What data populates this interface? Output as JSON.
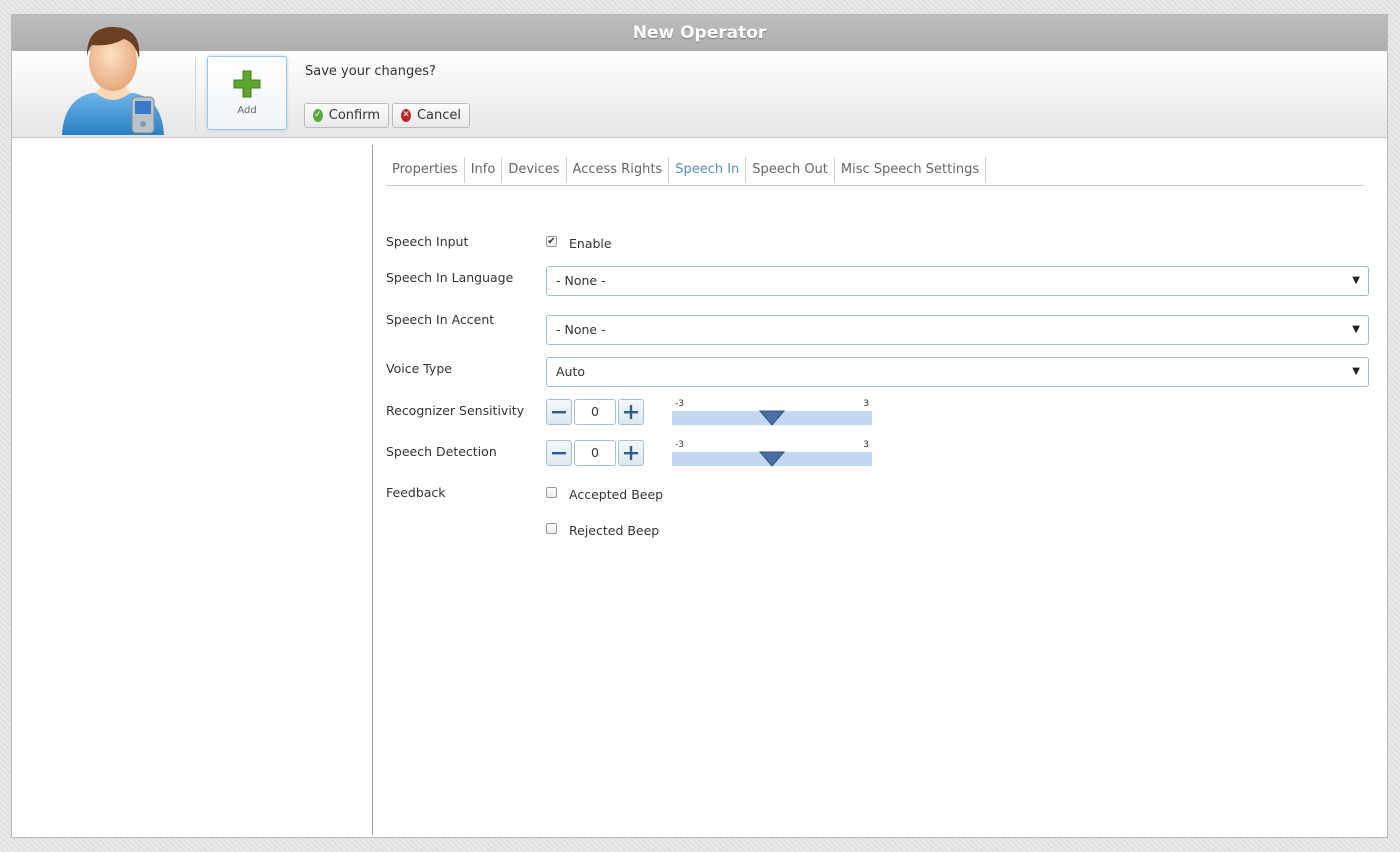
{
  "window": {
    "title": "New Operator"
  },
  "toolbar": {
    "add_label": "Add",
    "prompt": "Save your changes?",
    "confirm_label": "Confirm",
    "cancel_label": "Cancel"
  },
  "tabs": [
    {
      "label": "Properties"
    },
    {
      "label": "Info"
    },
    {
      "label": "Devices"
    },
    {
      "label": "Access Rights"
    },
    {
      "label": "Speech In",
      "active": true
    },
    {
      "label": "Speech Out"
    },
    {
      "label": "Misc Speech Settings"
    }
  ],
  "form": {
    "speech_input": {
      "label": "Speech Input",
      "checkbox_label": "Enable",
      "checked": true
    },
    "speech_in_language": {
      "label": "Speech In Language",
      "value": "- None -"
    },
    "speech_in_accent": {
      "label": "Speech In Accent",
      "value": "- None -"
    },
    "voice_type": {
      "label": "Voice Type",
      "value": "Auto"
    },
    "recognizer_sensitivity": {
      "label": "Recognizer Sensitivity",
      "value": "0",
      "min": "-3",
      "max": "3",
      "level": 0
    },
    "speech_detection": {
      "label": "Speech Detection",
      "value": "0",
      "min": "-3",
      "max": "3",
      "level": 0
    },
    "feedback": {
      "label": "Feedback",
      "accepted_beep": {
        "label": "Accepted Beep",
        "checked": false
      },
      "rejected_beep": {
        "label": "Rejected Beep",
        "checked": false
      }
    }
  },
  "colors": {
    "active_tab": "#5b8db8",
    "slider_track": "#c3d7f1",
    "slider_handle": "#4a6fa5",
    "confirm_icon": "#58a940",
    "cancel_icon": "#b8282a"
  }
}
